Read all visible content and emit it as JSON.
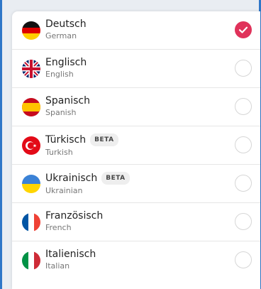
{
  "languages": [
    {
      "name": "Deutsch",
      "native": "German",
      "beta": false,
      "selected": true,
      "flag": "de-flag-icon"
    },
    {
      "name": "Englisch",
      "native": "English",
      "beta": false,
      "selected": false,
      "flag": "uk-flag-icon"
    },
    {
      "name": "Spanisch",
      "native": "Spanish",
      "beta": false,
      "selected": false,
      "flag": "es-flag-icon"
    },
    {
      "name": "Türkisch",
      "native": "Turkish",
      "beta": true,
      "selected": false,
      "flag": "tr-flag-icon"
    },
    {
      "name": "Ukrainisch",
      "native": "Ukrainian",
      "beta": true,
      "selected": false,
      "flag": "ua-flag-icon"
    },
    {
      "name": "Französisch",
      "native": "French",
      "beta": false,
      "selected": false,
      "flag": "fr-flag-icon"
    },
    {
      "name": "Italienisch",
      "native": "Italian",
      "beta": false,
      "selected": false,
      "flag": "it-flag-icon"
    }
  ],
  "beta_label": "BETA",
  "colors": {
    "accent": "#e0325a",
    "frame": "#2f77c8"
  }
}
